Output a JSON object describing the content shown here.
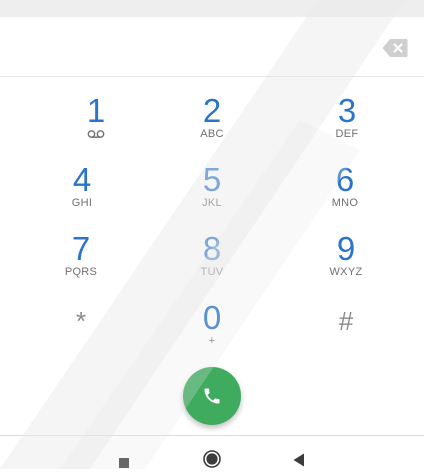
{
  "status_bar": {},
  "display": {
    "number_value": "",
    "backspace_icon": "backspace-icon"
  },
  "dialpad": {
    "keys": [
      {
        "digit": "1",
        "letters": "",
        "icon": "voicemail-icon"
      },
      {
        "digit": "2",
        "letters": "ABC"
      },
      {
        "digit": "3",
        "letters": "DEF"
      },
      {
        "digit": "4",
        "letters": "GHI"
      },
      {
        "digit": "5",
        "letters": "JKL"
      },
      {
        "digit": "6",
        "letters": "MNO"
      },
      {
        "digit": "7",
        "letters": "PQRS"
      },
      {
        "digit": "8",
        "letters": "TUV"
      },
      {
        "digit": "9",
        "letters": "WXYZ"
      },
      {
        "digit": "*",
        "letters": ""
      },
      {
        "digit": "0",
        "letters": "+"
      },
      {
        "digit": "#",
        "letters": ""
      }
    ]
  },
  "call_button": {
    "icon": "phone-icon",
    "color": "#3fab5e"
  },
  "navigation": {
    "recents_icon": "square-icon",
    "home_icon": "circle-icon",
    "back_icon": "back-triangle-icon"
  },
  "colors": {
    "digit": "#2b74c8",
    "letters": "#707070",
    "call": "#3fab5e"
  }
}
